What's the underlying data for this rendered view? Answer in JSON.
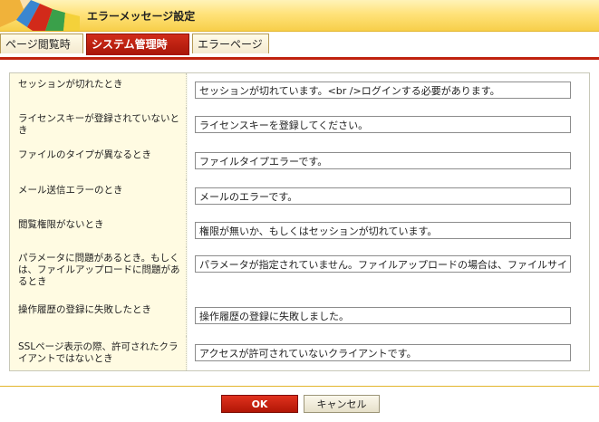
{
  "window": {
    "title": "エラーメッセージ設定"
  },
  "tabs": [
    {
      "label": "ページ閲覧時",
      "active": false
    },
    {
      "label": "システム管理時",
      "active": true
    },
    {
      "label": "エラーページ",
      "active": false
    }
  ],
  "rows": [
    {
      "label": "セッションが切れたとき",
      "value": "セッションが切れています。<br />ログインする必要があります。"
    },
    {
      "label": "ライセンスキーが登録されていないとき",
      "value": "ライセンスキーを登録してください。"
    },
    {
      "label": "ファイルのタイプが異なるとき",
      "value": "ファイルタイプエラーです。"
    },
    {
      "label": "メール送信エラーのとき",
      "value": "メールのエラーです。"
    },
    {
      "label": "閲覧権限がないとき",
      "value": "権限が無いか、もしくはセッションが切れています。"
    },
    {
      "label": "パラメータに問題があるとき。もしくは、ファイルアップロードに問題があるとき",
      "value": "パラメータが指定されていません。ファイルアップロードの場合は、ファイルサイ"
    },
    {
      "label": "操作履歴の登録に失敗したとき",
      "value": "操作履歴の登録に失敗しました。"
    },
    {
      "label": "SSLページ表示の際、許可されたクライアントではないとき",
      "value": "アクセスが許可されていないクライアントです。"
    }
  ],
  "buttons": {
    "ok": "OK",
    "cancel": "キャンセル"
  },
  "colors": {
    "accent_red": "#c0220e",
    "titlebar_yellow": "#ffe27a",
    "label_bg": "#fffbe2"
  }
}
